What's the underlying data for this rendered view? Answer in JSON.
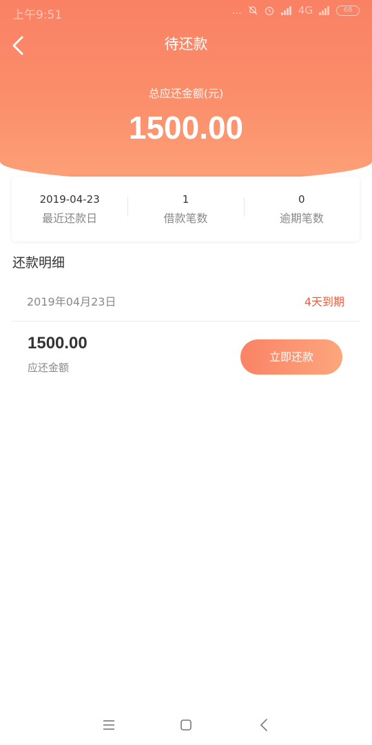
{
  "status_bar": {
    "time": "上午9:51",
    "network": "4G",
    "battery": "68",
    "dots": "..."
  },
  "nav": {
    "title": "待还款"
  },
  "total": {
    "label": "总应还金额(元)",
    "amount": "1500.00"
  },
  "summary": [
    {
      "value": "2019-04-23",
      "label": "最近还款日"
    },
    {
      "value": "1",
      "label": "借款笔数"
    },
    {
      "value": "0",
      "label": "逾期笔数"
    }
  ],
  "section_title": "还款明细",
  "detail": {
    "date": "2019年04月23日",
    "due": "4天到期",
    "amount": "1500.00",
    "amount_label": "应还金额",
    "pay_button": "立即还款"
  },
  "colors": {
    "accent": "#fa8164",
    "due_text": "#f05a3c"
  }
}
